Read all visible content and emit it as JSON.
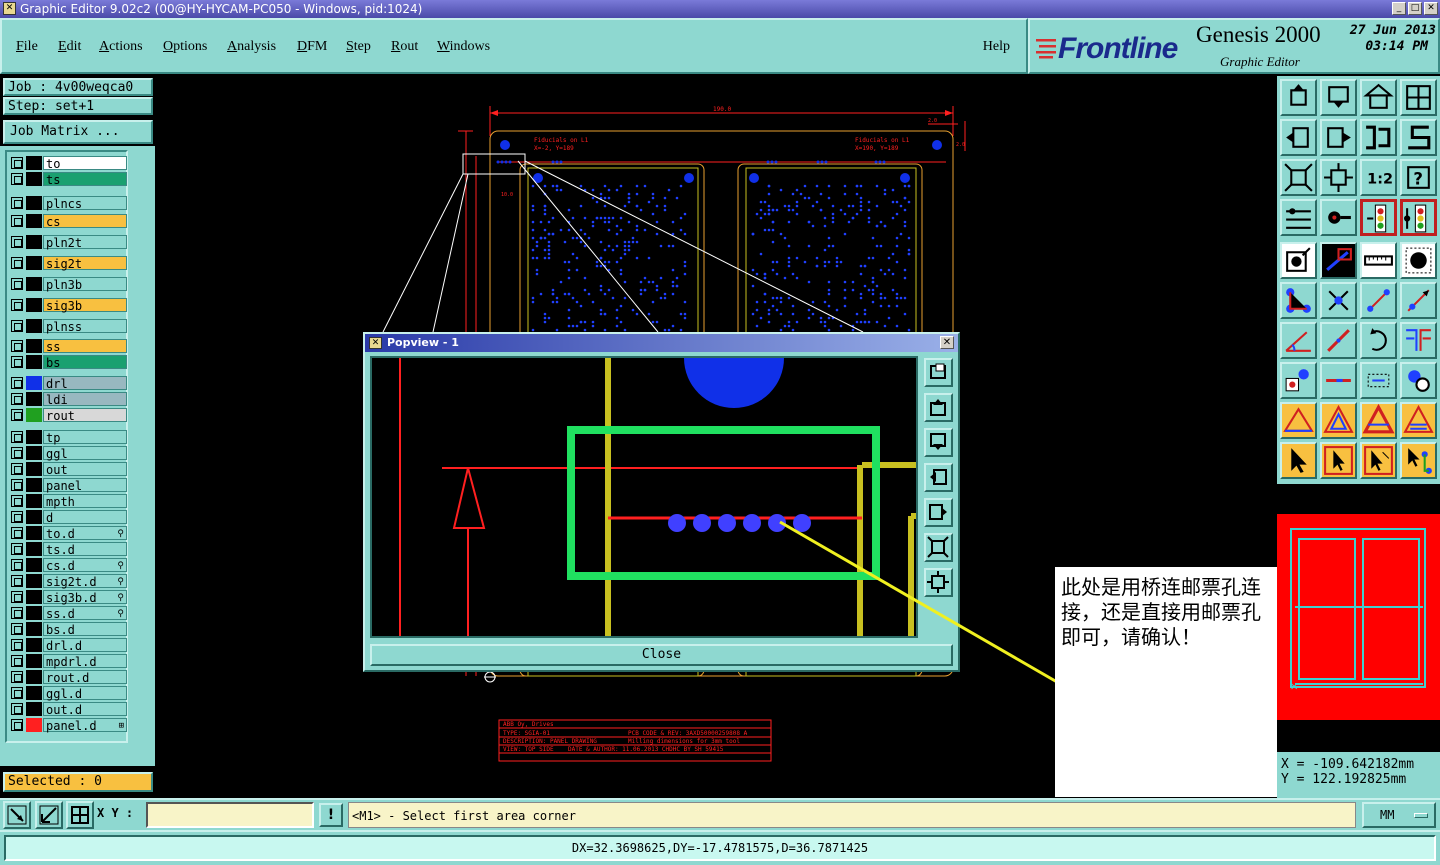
{
  "window": {
    "title": "Graphic Editor 9.02c2 (00@HY-HYCAM-PC050 - Windows, pid:1024)"
  },
  "menu": {
    "items": [
      "File",
      "Edit",
      "Actions",
      "Options",
      "Analysis",
      "DFM",
      "Step",
      "Rout",
      "Windows"
    ],
    "help": "Help"
  },
  "logo": {
    "brand": "Frontline",
    "product": "Genesis 2000",
    "subtitle": "Graphic Editor",
    "date": "27 Jun 2013",
    "time": "03:14 PM"
  },
  "job": {
    "job_label": "Job : 4v00weqca0",
    "step_label": "Step: set+1",
    "matrix_button": "Job Matrix ..."
  },
  "layers": [
    {
      "name": "to",
      "color": "#ffffff",
      "swatch": "#000000"
    },
    {
      "name": "ts",
      "color": "#1aa070",
      "swatch": "#000000"
    },
    {
      "name": "plncs",
      "color": "#8ed8d0",
      "swatch": "#000000"
    },
    {
      "name": "cs",
      "color": "#f8c040",
      "swatch": "#000000"
    },
    {
      "name": "pln2t",
      "color": "#8ed8d0",
      "swatch": "#000000"
    },
    {
      "name": "sig2t",
      "color": "#f8c040",
      "swatch": "#000000"
    },
    {
      "name": "pln3b",
      "color": "#8ed8d0",
      "swatch": "#000000"
    },
    {
      "name": "sig3b",
      "color": "#f8c040",
      "swatch": "#000000"
    },
    {
      "name": "plnss",
      "color": "#8ed8d0",
      "swatch": "#000000"
    },
    {
      "name": "ss",
      "color": "#f8c040",
      "swatch": "#000000"
    },
    {
      "name": "bs",
      "color": "#1aa070",
      "swatch": "#000000"
    },
    {
      "name": "drl",
      "color": "#98b8c0",
      "swatch": "#1030e8"
    },
    {
      "name": "ldi",
      "color": "#98b8c0",
      "swatch": "#000000"
    },
    {
      "name": "rout",
      "color": "#d8d8d8",
      "swatch": "#20a020"
    },
    {
      "name": "tp",
      "color": "#8ed8d0",
      "swatch": "#000000"
    },
    {
      "name": "ggl",
      "color": "#8ed8d0",
      "swatch": "#000000"
    },
    {
      "name": "out",
      "color": "#8ed8d0",
      "swatch": "#000000"
    },
    {
      "name": "panel",
      "color": "#8ed8d0",
      "swatch": "#000000"
    },
    {
      "name": "mpth",
      "color": "#8ed8d0",
      "swatch": "#000000"
    },
    {
      "name": "d",
      "color": "#8ed8d0",
      "swatch": "#000000"
    },
    {
      "name": "to.d",
      "color": "#8ed8d0",
      "swatch": "#000000",
      "lock": "⚲"
    },
    {
      "name": "ts.d",
      "color": "#8ed8d0",
      "swatch": "#000000"
    },
    {
      "name": "cs.d",
      "color": "#8ed8d0",
      "swatch": "#000000",
      "lock": "⚲"
    },
    {
      "name": "sig2t.d",
      "color": "#8ed8d0",
      "swatch": "#000000",
      "lock": "⚲"
    },
    {
      "name": "sig3b.d",
      "color": "#8ed8d0",
      "swatch": "#000000",
      "lock": "⚲"
    },
    {
      "name": "ss.d",
      "color": "#8ed8d0",
      "swatch": "#000000",
      "lock": "⚲"
    },
    {
      "name": "bs.d",
      "color": "#8ed8d0",
      "swatch": "#000000"
    },
    {
      "name": "drl.d",
      "color": "#8ed8d0",
      "swatch": "#000000"
    },
    {
      "name": "mpdrl.d",
      "color": "#8ed8d0",
      "swatch": "#000000"
    },
    {
      "name": "rout.d",
      "color": "#8ed8d0",
      "swatch": "#000000"
    },
    {
      "name": "ggl.d",
      "color": "#8ed8d0",
      "swatch": "#000000"
    },
    {
      "name": "out.d",
      "color": "#8ed8d0",
      "swatch": "#000000"
    },
    {
      "name": "panel.d",
      "color": "#8ed8d0",
      "swatch": "#ff2020",
      "lock": "⊞"
    }
  ],
  "selected": {
    "label": "Selected : 0"
  },
  "popview": {
    "title": "Popview - 1",
    "close_label": "Close"
  },
  "note": {
    "text": "此处是用桥连邮票孔连接，还是直接用邮票孔即可，请确认！"
  },
  "cad_texts": {
    "fid_left": "Fiducials on L1",
    "fid_left_xy": "X=-2, Y=189",
    "fid_right": "Fiducials on L1",
    "fid_right_xy": "X=190, Y=189",
    "dim_top": "190.0",
    "dim_small": "2.0",
    "dim_side": "2.0",
    "dim_left": "10.0"
  },
  "title_block": {
    "company": "ABB Oy, Drives",
    "type": "TYPE: SGIA-01",
    "pcb_code": "PCB CODE & REV: 3AXD50000259808 A",
    "desc": "DESCRIPTION: PANEL DRAWING",
    "milling": "Milling dimensions for 3mm tool",
    "view": "VIEW: TOP SIDE",
    "date_author": "DATE & AUTHOR: 11.06.2013 CHDHC BY SH 59415"
  },
  "coords": {
    "x": "X = -109.642182mm",
    "y": "Y = 122.192825mm"
  },
  "bottom": {
    "xy_label": "X Y :",
    "xy_value": "",
    "excl": "!",
    "prompt": "<M1> - Select first area corner",
    "units": "MM"
  },
  "status": {
    "text": "DX=32.3698625,DY=-17.4781575,D=36.7871425"
  },
  "icons": {
    "toolbar": [
      "home-icon",
      "fit-icon",
      "zoom-icon",
      "grid-icon"
    ]
  }
}
